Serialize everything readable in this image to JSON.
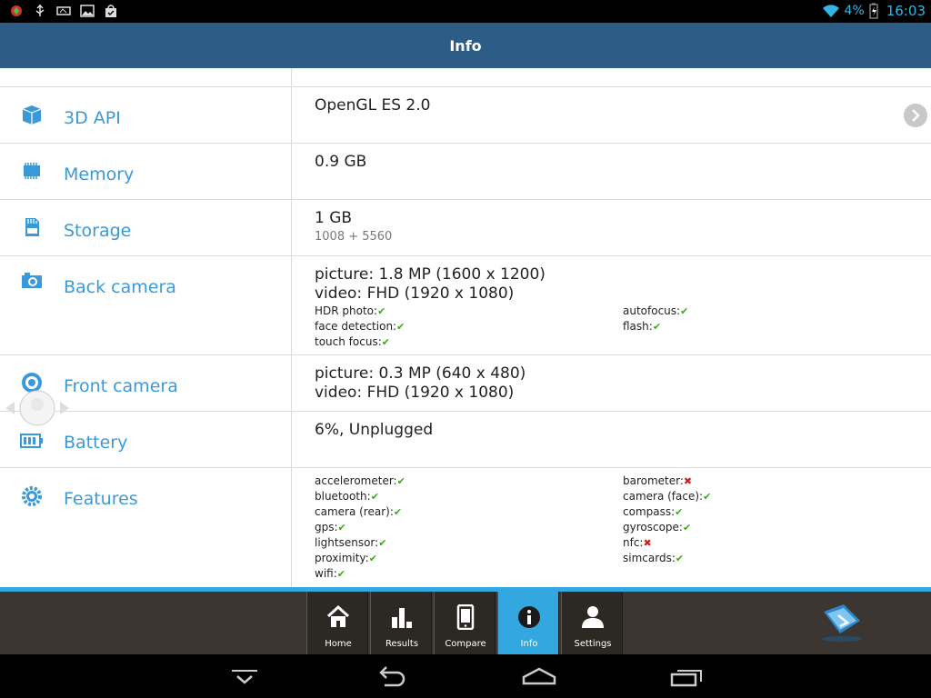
{
  "status_bar": {
    "battery_percent": "4%",
    "time": "16:03",
    "icons": [
      "app-notification-icon",
      "usb-icon",
      "device-icon",
      "image-icon",
      "shopping-bag-icon",
      "wifi-icon",
      "battery-charging-icon"
    ]
  },
  "action_bar": {
    "title": "Info"
  },
  "rows": {
    "api": {
      "label": "3D API",
      "value": "OpenGL ES 2.0",
      "icon": "cube-icon"
    },
    "memory": {
      "label": "Memory",
      "value": "0.9 GB",
      "icon": "chip-icon"
    },
    "storage": {
      "label": "Storage",
      "value": "1 GB",
      "sub": "1008 + 5560",
      "icon": "sd-card-icon"
    },
    "back_camera": {
      "label": "Back camera",
      "value1": "picture: 1.8 MP (1600 x 1200)",
      "value2": "video: FHD (1920 x 1080)",
      "icon": "camera-icon",
      "features_left": [
        {
          "name": "HDR photo:",
          "ok": true
        },
        {
          "name": "face detection:",
          "ok": true
        },
        {
          "name": "touch focus:",
          "ok": true
        }
      ],
      "features_right": [
        {
          "name": "autofocus:",
          "ok": true
        },
        {
          "name": "flash:",
          "ok": true
        }
      ]
    },
    "front_camera": {
      "label": "Front camera",
      "value1": "picture: 0.3 MP (640 x 480)",
      "value2": "video: FHD (1920 x 1080)",
      "icon": "front-camera-icon"
    },
    "battery": {
      "label": "Battery",
      "value": "6%, Unplugged",
      "icon": "battery-icon"
    },
    "features": {
      "label": "Features",
      "icon": "gear-icon",
      "left": [
        {
          "name": "accelerometer:",
          "ok": true
        },
        {
          "name": "bluetooth:",
          "ok": true
        },
        {
          "name": "camera (rear):",
          "ok": true
        },
        {
          "name": "gps:",
          "ok": true
        },
        {
          "name": "lightsensor:",
          "ok": true
        },
        {
          "name": "proximity:",
          "ok": true
        },
        {
          "name": "wifi:",
          "ok": true
        }
      ],
      "right": [
        {
          "name": "barometer:",
          "ok": false
        },
        {
          "name": "camera (face):",
          "ok": true
        },
        {
          "name": "compass:",
          "ok": true
        },
        {
          "name": "gyroscope:",
          "ok": true
        },
        {
          "name": "nfc:",
          "ok": false
        },
        {
          "name": "simcards:",
          "ok": true
        }
      ]
    }
  },
  "tabs": [
    {
      "label": "Home",
      "icon": "home-icon",
      "active": false
    },
    {
      "label": "Results",
      "icon": "bar-chart-icon",
      "active": false
    },
    {
      "label": "Compare",
      "icon": "phone-icon",
      "active": false
    },
    {
      "label": "Info",
      "icon": "info-icon",
      "active": true
    },
    {
      "label": "Settings",
      "icon": "person-icon",
      "active": false
    }
  ],
  "colors": {
    "action_bar": "#2d5c86",
    "accent": "#33a7e0",
    "label": "#3a9ad9",
    "check": "#3aaa16",
    "cross": "#d41c1c"
  }
}
